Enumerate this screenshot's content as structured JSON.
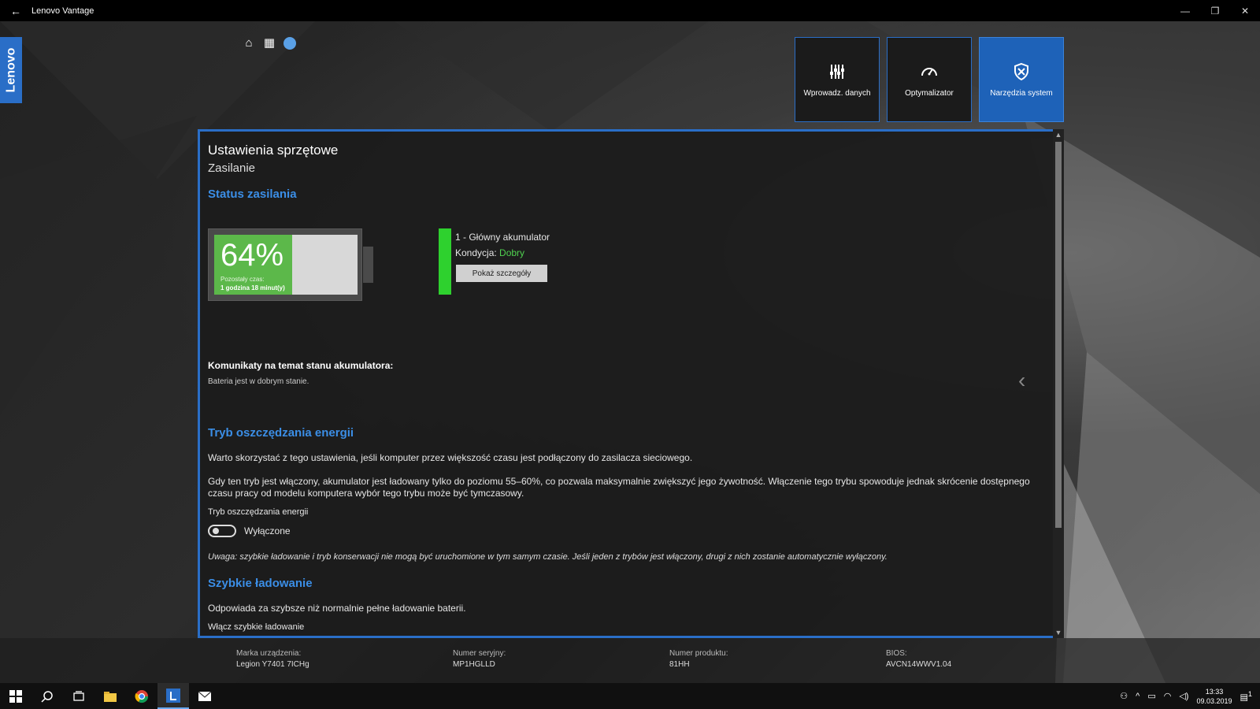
{
  "window": {
    "title": "Lenovo Vantage",
    "back_icon": "←",
    "minimize_icon": "—",
    "restore_icon": "❐",
    "close_icon": "✕"
  },
  "brand": {
    "logo_text": "Lenovo",
    "color": "#2a6ec7"
  },
  "topnav": {
    "home_icon": "⌂",
    "apps_icon": "▦"
  },
  "tiles": [
    {
      "label": "Wprowadz. danych",
      "icon": "equalizer-icon"
    },
    {
      "label": "Optymalizator",
      "icon": "speedometer-icon"
    },
    {
      "label": "Narzędzia system",
      "icon": "shield-tools-icon",
      "active": true
    }
  ],
  "page": {
    "title": "Ustawienia sprzętowe",
    "subtitle": "Zasilanie",
    "status_title": "Status zasilania",
    "battery": {
      "percent_label": "64%",
      "percent": 64,
      "remaining_label": "Pozostały czas:",
      "remaining_value": "1 godzina 18 minut(y)"
    },
    "battery_info": {
      "name": "1 - Główny akumulator",
      "condition_label": "Kondycja: ",
      "condition_value": "Dobry",
      "details_button": "Pokaż szczegóły"
    },
    "messages_title": "Komunikaty na temat stanu akumulatora:",
    "messages_text": "Bateria jest w dobrym stanie.",
    "saving": {
      "title": "Tryb oszczędzania energii",
      "p1": "Warto skorzystać z tego ustawienia, jeśli komputer przez większość czasu jest podłączony do zasilacza sieciowego.",
      "p2": "Gdy ten tryb jest włączony, akumulator jest ładowany tylko do poziomu 55–60%, co pozwala maksymalnie zwiększyć jego żywotność. Włączenie tego trybu spowoduje jednak skrócenie dostępnego czasu pracy od modelu komputera wybór tego trybu może być tymczasowy.",
      "toggle_label": "Tryb oszczędzania energii",
      "toggle_state": "Wyłączone",
      "note": "Uwaga: szybkie ładowanie i tryb konserwacji nie mogą być uruchomione w tym samym czasie. Jeśli jeden z trybów jest włączony, drugi z nich zostanie automatycznie wyłączony."
    },
    "fast": {
      "title": "Szybkie ładowanie",
      "p1": "Odpowiada za szybsze niż normalnie pełne ładowanie baterii.",
      "toggle_label": "Włącz szybkie ładowanie"
    }
  },
  "footer": {
    "brand_label": "Marka urządzenia:",
    "brand_value": "Legion Y7401 7ICHg",
    "serial_label": "Numer seryjny:",
    "serial_value": "MP1HGLLD",
    "product_label": "Numer produktu:",
    "product_value": "81HH",
    "bios_label": "BIOS:",
    "bios_value": "AVCN14WWV1.04"
  },
  "taskbar": {
    "time": "13:33",
    "date": "09.03.2019",
    "notification_count": "1"
  },
  "scrollbar": {
    "up": "▲",
    "down": "▼"
  }
}
